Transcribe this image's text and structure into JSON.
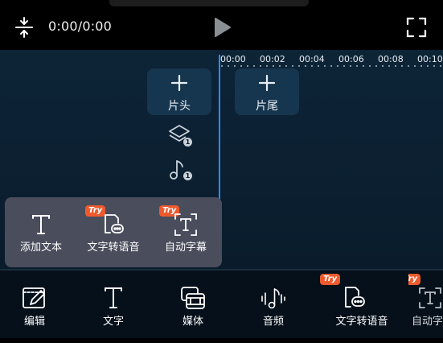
{
  "player": {
    "time": "0:00/0:00",
    "icons": {
      "collapse": "collapse-vertical-icon",
      "play": "play-icon",
      "fullscreen": "fullscreen-icon"
    }
  },
  "timeline": {
    "ticks": [
      "00:00",
      "00:02",
      "00:04",
      "00:06",
      "00:08",
      "00:10"
    ],
    "clip_start_label": "片头",
    "clip_end_label": "片尾",
    "layer_count": "1",
    "audio_count": "1"
  },
  "popup_menu": {
    "items": [
      {
        "label": "添加文本",
        "icon": "text-icon",
        "badge": ""
      },
      {
        "label": "文字转语音",
        "icon": "text-to-speech-icon",
        "badge": "Try"
      },
      {
        "label": "自动字幕",
        "icon": "auto-caption-icon",
        "badge": "Try"
      }
    ]
  },
  "toolbar": {
    "items": [
      {
        "label": "编辑",
        "icon": "edit-icon",
        "badge": ""
      },
      {
        "label": "文字",
        "icon": "text-icon",
        "badge": ""
      },
      {
        "label": "媒体",
        "icon": "media-icon",
        "badge": ""
      },
      {
        "label": "音频",
        "icon": "audio-icon",
        "badge": ""
      },
      {
        "label": "文字转语音",
        "icon": "text-to-speech-icon",
        "badge": "Try"
      },
      {
        "label": "自动字",
        "icon": "auto-caption-icon",
        "badge": "Try"
      }
    ]
  },
  "colors": {
    "accent_blue": "#2f8cff",
    "try_badge": "#ee5a2e",
    "popup_bg": "#4a4d5c"
  }
}
